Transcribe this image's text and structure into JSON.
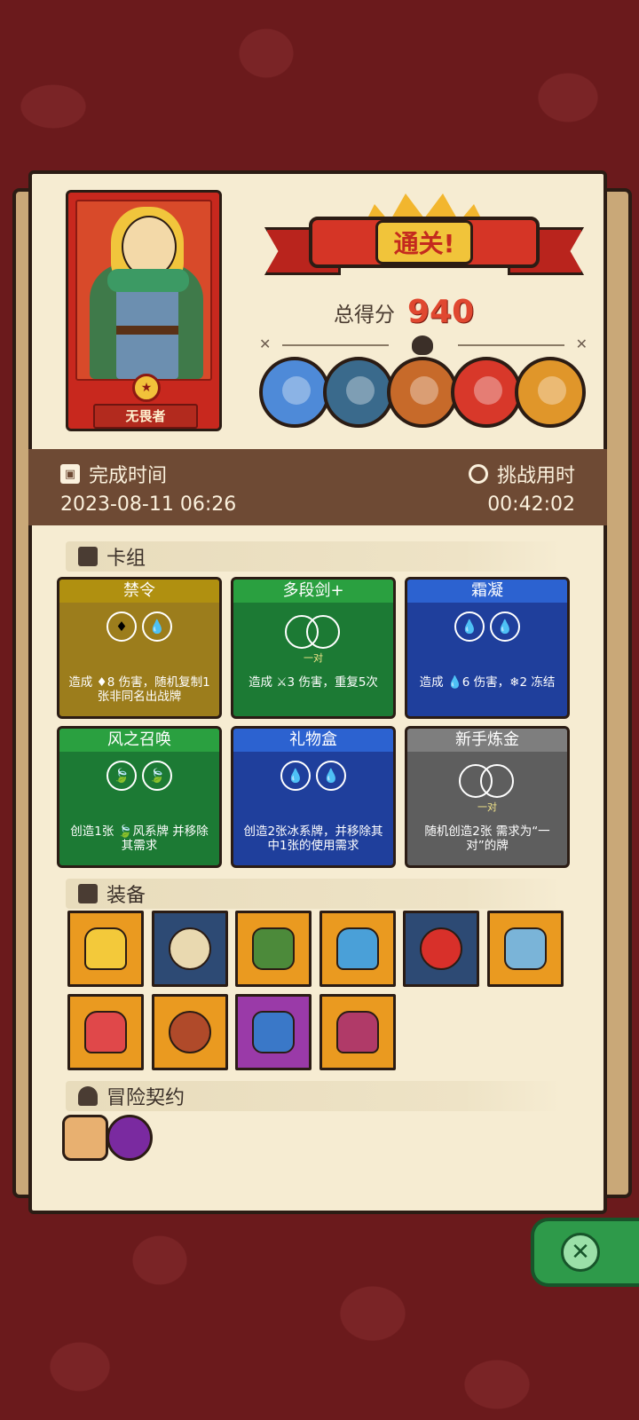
{
  "hero": {
    "name": "无畏者"
  },
  "result": {
    "banner": "通关!",
    "score_label": "总得分",
    "score": "940"
  },
  "bosses": [
    {
      "icon": "mushroom-boss-icon",
      "color": "#4e8ad8"
    },
    {
      "icon": "ghost-king-boss-icon",
      "color": "#3a6a8c"
    },
    {
      "icon": "bird-boss-icon",
      "color": "#c76a2a"
    },
    {
      "icon": "demon-mask-boss-icon",
      "color": "#d8382a"
    },
    {
      "icon": "crystal-golem-boss-icon",
      "color": "#e0962a"
    }
  ],
  "info": {
    "finish_label": "完成时间",
    "finish_value": "2023-08-11 06:26",
    "duration_label": "挑战用时",
    "duration_value": "00:42:02"
  },
  "sections": {
    "deck": "卡组",
    "equipment": "装备",
    "contracts": "冒险契约"
  },
  "cards": [
    {
      "title": "禁令",
      "head_color": "#b09010",
      "body_color": "#9c7d1c",
      "desc": "造成 ♦8 伤害，随机复制1张非同名出战牌",
      "circles": [
        "♦",
        "💧"
      ],
      "pair_label": ""
    },
    {
      "title": "多段剑+",
      "head_color": "#2aa040",
      "body_color": "#1c7a34",
      "desc": "造成 ⚔3 伤害，重复5次",
      "circles": [],
      "pair_label": "一对"
    },
    {
      "title": "霜凝",
      "head_color": "#2c62d0",
      "body_color": "#1f3f9c",
      "desc": "造成 💧6 伤害，❄2 冻结",
      "circles": [
        "💧",
        "💧"
      ],
      "pair_label": ""
    },
    {
      "title": "风之召唤",
      "head_color": "#2aa040",
      "body_color": "#1c7a34",
      "desc": "创造1张 🍃风系牌 并移除其需求",
      "circles": [
        "🍃",
        "🍃"
      ],
      "pair_label": ""
    },
    {
      "title": "礼物盒",
      "head_color": "#2c62d0",
      "body_color": "#1f3f9c",
      "desc": "创造2张冰系牌，并移除其中1张的使用需求",
      "circles": [
        "💧",
        "💧"
      ],
      "pair_label": ""
    },
    {
      "title": "新手炼金",
      "head_color": "#7e7e7e",
      "body_color": "#5e5e5e",
      "desc": "随机创造2张 需求为“一对”的牌",
      "circles": [],
      "pair_label": "一对"
    }
  ],
  "equipment": [
    {
      "icon": "golden-crown-icon",
      "bg": "#ea9a20",
      "fg": "#f3c93a"
    },
    {
      "icon": "ice-scroll-icon",
      "bg": "#2d4a74",
      "fg": "#e9d9b0"
    },
    {
      "icon": "turtle-shell-icon",
      "bg": "#ea9a20",
      "fg": "#4c8a3a"
    },
    {
      "icon": "frost-shield-icon",
      "bg": "#ea9a20",
      "fg": "#4aa0d8"
    },
    {
      "icon": "red-gem-icon",
      "bg": "#2d4a74",
      "fg": "#d8302a"
    },
    {
      "icon": "ice-blade-icon",
      "bg": "#ea9a20",
      "fg": "#7ab4d8"
    },
    {
      "icon": "fire-feather-icon",
      "bg": "#ea9a20",
      "fg": "#e0484a"
    },
    {
      "icon": "lava-stone-icon",
      "bg": "#ea9a20",
      "fg": "#b04a2a"
    },
    {
      "icon": "blue-amulet-icon",
      "bg": "#9a3aa8",
      "fg": "#3a78c8"
    },
    {
      "icon": "cursed-heart-icon",
      "bg": "#ea9a20",
      "fg": "#b03a68"
    }
  ],
  "contracts": [
    {
      "icon": "contract-scroll-icon",
      "color": "#e8b070"
    },
    {
      "icon": "purple-beast-icon",
      "color": "#7a2aa0"
    }
  ],
  "close": {
    "icon": "close-icon"
  }
}
